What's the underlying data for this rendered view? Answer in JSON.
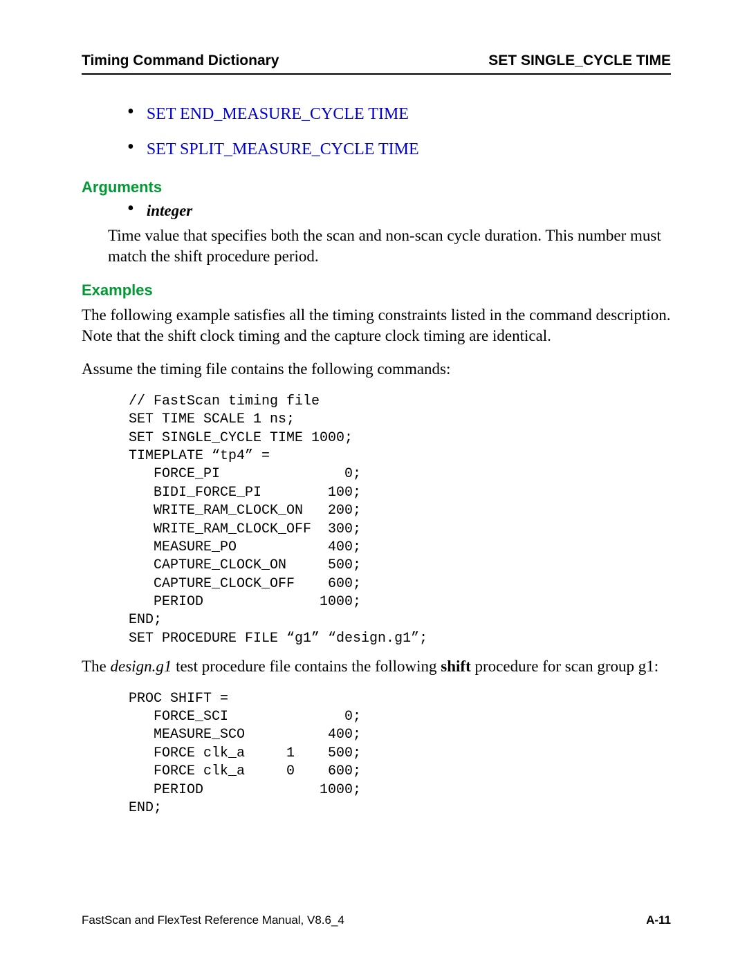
{
  "header": {
    "left": "Timing Command Dictionary",
    "right": "SET SINGLE_CYCLE TIME"
  },
  "top_links": [
    "SET END_MEASURE_CYCLE TIME",
    "SET SPLIT_MEASURE_CYCLE TIME"
  ],
  "sections": {
    "arguments": {
      "heading": "Arguments",
      "arg_name": "integer",
      "arg_desc_1": "Time value that specifies both the scan and non-scan cycle duration. This number must match the ",
      "arg_desc_bold": "shift",
      "arg_desc_2": " procedure period."
    },
    "examples": {
      "heading": "Examples",
      "para1": "The following example satisfies all the timing constraints listed in the command description. Note that the shift clock timing and the capture clock timing are identical.",
      "para2": "Assume the timing file contains the following commands:",
      "code1": "// FastScan timing file\nSET TIME SCALE 1 ns;\nSET SINGLE_CYCLE TIME 1000;\nTIMEPLATE “tp4” =\n   FORCE_PI               0;\n   BIDI_FORCE_PI        100;\n   WRITE_RAM_CLOCK_ON   200;\n   WRITE_RAM_CLOCK_OFF  300;\n   MEASURE_PO           400;\n   CAPTURE_CLOCK_ON     500;\n   CAPTURE_CLOCK_OFF    600;\n   PERIOD              1000;\nEND;\nSET PROCEDURE FILE “g1” “design.g1”;",
      "para3_pre": "The ",
      "para3_italic": "design.g1",
      "para3_mid": " test procedure file contains the following ",
      "para3_bold": "shift",
      "para3_post": " procedure for scan group g1:",
      "code2": "PROC SHIFT =\n   FORCE_SCI              0;\n   MEASURE_SCO          400;\n   FORCE clk_a     1    500;\n   FORCE clk_a     0    600;\n   PERIOD              1000;\nEND;"
    }
  },
  "footer": {
    "left": "FastScan and FlexTest Reference Manual, V8.6_4",
    "right": "A-11"
  }
}
